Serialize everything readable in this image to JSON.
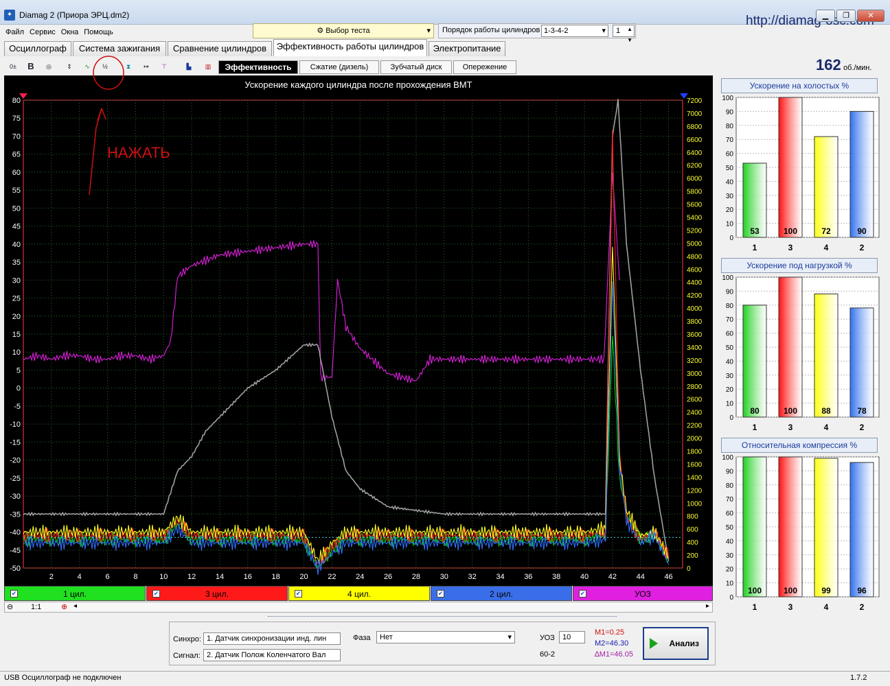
{
  "window": {
    "title": "Diamag 2 (Приора ЭРЦ.dm2)",
    "url": "http://diamag-osc.com"
  },
  "menu": [
    "Файл",
    "Сервис",
    "Окна",
    "Помощь"
  ],
  "test_select": "Выбор теста",
  "cylinder_order": {
    "label": "Порядок работы цилиндров",
    "value": "1-3-4-2",
    "spin": "1"
  },
  "tabs": [
    "Осциллограф",
    "Система зажигания",
    "Сравнение цилиндров",
    "Эффективность работы цилиндров",
    "Электропитание"
  ],
  "subtabs": [
    "Эффективность",
    "Сжатие (дизель)",
    "Зубчатый диск",
    "Опережение"
  ],
  "rpm": {
    "value": "162",
    "unit": "об./мин."
  },
  "annotation": {
    "text": "НАЖАТЬ"
  },
  "chart": {
    "title": "Ускорение каждого цилиндра после прохождения ВМТ"
  },
  "chart_data": [
    {
      "type": "line",
      "title": "Ускорение каждого цилиндра после прохождения ВМТ",
      "x_ticks": [
        2,
        4,
        6,
        8,
        10,
        12,
        14,
        16,
        18,
        20,
        22,
        24,
        26,
        28,
        30,
        32,
        34,
        36,
        38,
        40,
        42,
        44,
        46
      ],
      "y_ticks": [
        80,
        75,
        70,
        65,
        60,
        55,
        50,
        45,
        40,
        35,
        30,
        25,
        20,
        15,
        10,
        5,
        0,
        -5,
        -10,
        -15,
        -20,
        -25,
        -30,
        -35,
        -40,
        -45,
        -50
      ],
      "y2_ticks": [
        7200,
        7000,
        6800,
        6600,
        6400,
        6200,
        6000,
        5800,
        5600,
        5400,
        5200,
        5000,
        4800,
        4600,
        4400,
        4200,
        4000,
        3800,
        3600,
        3400,
        3200,
        3000,
        2800,
        2600,
        2400,
        2200,
        2000,
        1800,
        1600,
        1400,
        1200,
        1000,
        800,
        600,
        400,
        200,
        0
      ],
      "xlim": [
        0,
        47
      ],
      "ylim": [
        -50,
        80
      ],
      "y2lim": [
        0,
        7200
      ],
      "series": [
        {
          "name": "УОЗ",
          "color": "#e020e0",
          "x": [
            0,
            1,
            2,
            3,
            4,
            5,
            6,
            7,
            8,
            9,
            10,
            10.5,
            11,
            12,
            14,
            16,
            18,
            20,
            21,
            21.2,
            22,
            22.4,
            23,
            24,
            26,
            28,
            29,
            30,
            32,
            34,
            36,
            38,
            40,
            41.4,
            42,
            42.5
          ],
          "y": [
            8,
            9,
            8,
            9,
            9,
            8,
            8,
            9,
            9,
            8,
            9,
            13,
            31,
            34,
            37,
            38,
            39,
            40,
            40,
            3,
            3,
            30,
            17,
            11,
            4,
            2,
            8,
            8,
            8,
            8,
            8,
            8,
            8,
            8,
            60,
            30
          ]
        },
        {
          "name": "gray",
          "color": "#a0a0a0",
          "x": [
            0,
            10,
            11,
            12,
            13,
            14,
            16,
            18,
            20,
            21,
            22,
            23,
            24,
            26,
            30,
            40,
            41.5,
            42,
            42.4,
            43,
            44,
            45,
            46
          ],
          "y": [
            -35,
            -35,
            -23,
            -19,
            -12,
            -8,
            0,
            5,
            12,
            12,
            -8,
            -23,
            -28,
            -33,
            -35,
            -35,
            -35,
            70,
            80,
            40,
            5,
            -25,
            -48
          ]
        },
        {
          "name": "1 цил.",
          "color": "#00d000",
          "x": [
            0,
            10,
            11,
            12,
            20,
            21,
            22,
            23,
            24,
            40,
            41.5,
            42,
            42.5,
            43,
            44,
            45,
            46
          ],
          "y": [
            -42,
            -42,
            -38,
            -42,
            -42,
            -50,
            -45,
            -42,
            -42,
            -42,
            -41,
            15,
            -25,
            -35,
            -42,
            -41,
            -48
          ]
        },
        {
          "name": "3 цил.",
          "color": "#ff2020",
          "x": [
            0,
            10,
            11,
            12,
            20,
            21,
            22,
            23,
            24,
            40,
            41.5,
            42,
            42.5,
            43,
            44,
            45,
            46
          ],
          "y": [
            -41,
            -41,
            -37,
            -41,
            -41,
            -49,
            -44,
            -41,
            -41,
            -41,
            -40,
            70,
            -18,
            -36,
            -42,
            -40,
            -47
          ]
        },
        {
          "name": "4 цил.",
          "color": "#ffff20",
          "x": [
            0,
            10,
            11,
            12,
            20,
            21,
            22,
            23,
            24,
            40,
            41.5,
            42,
            42.5,
            43,
            44,
            45,
            46
          ],
          "y": [
            -40,
            -40,
            -36,
            -40,
            -40,
            -48,
            -43,
            -40,
            -40,
            -40,
            -39,
            40,
            -20,
            -34,
            -41,
            -40,
            -47
          ]
        },
        {
          "name": "2 цил.",
          "color": "#3070ff",
          "x": [
            0,
            10,
            11,
            12,
            20,
            21,
            22,
            23,
            24,
            40,
            41.5,
            42,
            42.5,
            43,
            44,
            45,
            46
          ],
          "y": [
            -43,
            -43,
            -39,
            -43,
            -43,
            -50,
            -46,
            -43,
            -43,
            -43,
            -42,
            30,
            -22,
            -37,
            -43,
            -41,
            -49
          ]
        }
      ]
    },
    {
      "type": "bar",
      "title": "Ускорение на холостых %",
      "categories": [
        "1",
        "3",
        "4",
        "2"
      ],
      "values": [
        53,
        100,
        72,
        90
      ],
      "ylim": [
        0,
        100
      ]
    },
    {
      "type": "bar",
      "title": "Ускорение под нагрузкой %",
      "categories": [
        "1",
        "3",
        "4",
        "2"
      ],
      "values": [
        80,
        100,
        88,
        78
      ],
      "ylim": [
        0,
        100
      ]
    },
    {
      "type": "bar",
      "title": "Относительная компрессия %",
      "categories": [
        "1",
        "3",
        "4",
        "2"
      ],
      "values": [
        100,
        100,
        99,
        96
      ],
      "ylim": [
        0,
        100
      ]
    }
  ],
  "bar_colors": [
    "#20d020",
    "#ff1010",
    "#ffff10",
    "#3070f0"
  ],
  "legend": [
    {
      "label": "1 цил.",
      "color": "#20e020"
    },
    {
      "label": "3 цил.",
      "color": "#ff1a1a"
    },
    {
      "label": "4 цил.",
      "color": "#ffff00"
    },
    {
      "label": "2 цил.",
      "color": "#3a6ee8"
    },
    {
      "label": "УОЗ",
      "color": "#e020e0"
    }
  ],
  "zoom": "1:1",
  "bottom": {
    "sync_label": "Синхро:",
    "sync_value": "1. Датчик синхронизации инд. лин",
    "signal_label": "Сигнал:",
    "signal_value": "2. Датчик Полож Коленчатого Вал",
    "phase_label": "Фаза",
    "phase_value": "Нет",
    "uoz_label": "УОЗ",
    "uoz_value": "10",
    "wheel": "60-2",
    "m1": "M1=0.25",
    "m2": "M2=46.30",
    "dm": "∆M1=46.05",
    "analyze": "Анализ"
  },
  "status": {
    "text": "USB Осциллограф не подключен",
    "version": "1.7.2"
  }
}
